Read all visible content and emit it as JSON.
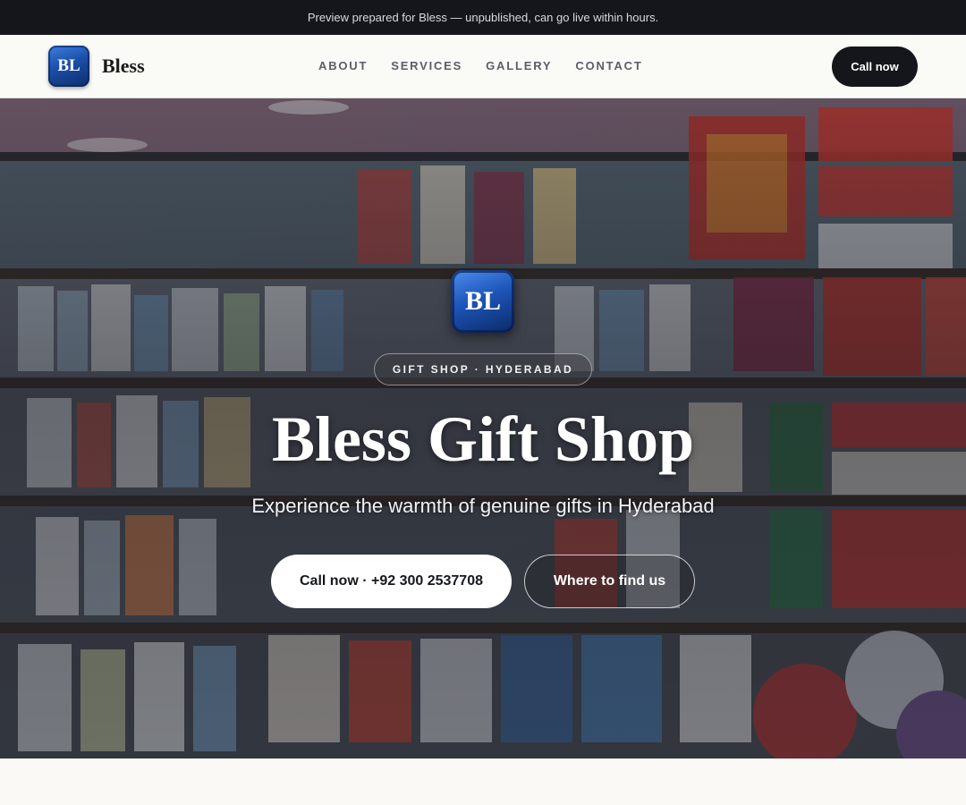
{
  "banner": {
    "text": "Preview prepared for Bless — unpublished, can go live within hours."
  },
  "header": {
    "logo_initials": "BL",
    "brand_name": "Bless",
    "nav": [
      "ABOUT",
      "SERVICES",
      "GALLERY",
      "CONTACT"
    ],
    "call_label": "Call now"
  },
  "hero": {
    "logo_initials": "BL",
    "tagline": "GIFT SHOP · HYDERABAD",
    "title": "Bless Gift Shop",
    "subtitle": "Experience the warmth of genuine gifts in Hyderabad",
    "primary_button": "Call now · +92 300 2537708",
    "secondary_button": "Where to find us",
    "background_image": "gift-shop-shelves-photo"
  },
  "colors": {
    "dark": "#14161b",
    "page_background": "#faf9f5",
    "logo_blue": "#1d55b8"
  }
}
